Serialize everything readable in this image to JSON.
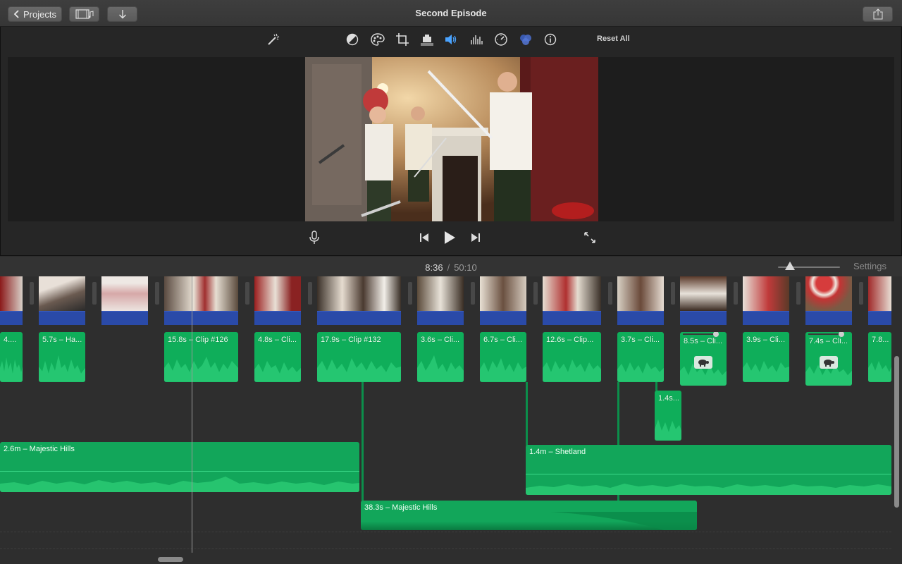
{
  "window": {
    "title": "Second Episode"
  },
  "titlebar": {
    "projects_label": "Projects"
  },
  "toolbar": {
    "reset_all_label": "Reset All",
    "icons": [
      "magic-wand-icon",
      "color-balance-icon",
      "color-palette-icon",
      "crop-icon",
      "stabilization-icon",
      "volume-icon",
      "equalizer-icon",
      "speed-icon",
      "filter-icon",
      "info-icon"
    ],
    "active_icon": "volume-icon",
    "active_color": "#4aa3ff"
  },
  "timecode": {
    "current": "8:36",
    "separator": "/",
    "total": "50:10"
  },
  "timeline_header": {
    "settings_label": "Settings"
  },
  "video_clips": [
    {
      "label": "4...."
    },
    {
      "label": "5.7s – Ha..."
    },
    {
      "label": ""
    },
    {
      "label": "15.8s – Clip #126"
    },
    {
      "label": "4.8s – Cli..."
    },
    {
      "label": "17.9s – Clip #132"
    },
    {
      "label": "3.6s – Cli..."
    },
    {
      "label": "6.7s – Cli..."
    },
    {
      "label": "12.6s – Clip..."
    },
    {
      "label": "3.7s – Cli..."
    },
    {
      "label": "8.5s – Cli..."
    },
    {
      "label": "3.9s – Cli..."
    },
    {
      "label": "7.4s – Cli..."
    },
    {
      "label": "7.8..."
    }
  ],
  "detached_clip": {
    "label": "1.4s..."
  },
  "music_clips": [
    {
      "label": "2.6m – Majestic Hills"
    },
    {
      "label": "1.4m – Shetland"
    },
    {
      "label": "38.3s – Majestic Hills"
    }
  ],
  "colors": {
    "audio_green": "#0fae5a",
    "blue_strip": "#2a4aa8",
    "music_green": "#12a65a"
  }
}
